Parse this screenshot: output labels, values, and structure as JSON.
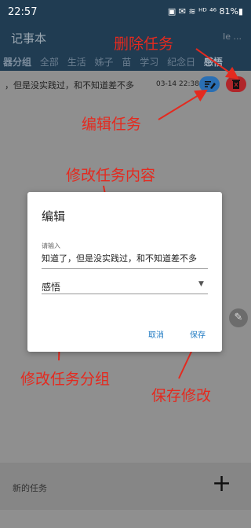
{
  "status_bar": {
    "time": "22:57",
    "indicators": "▣ ✉ ≋ ᴴᴰ ⁴⁶ 81%▮"
  },
  "app_bar": {
    "title": "记事本",
    "right_text": "Ie  ..."
  },
  "tabs": [
    "器分组",
    "全部",
    "生活",
    "姊子",
    "苗",
    "学习",
    "纪念日",
    "感悟"
  ],
  "task": {
    "text": "，但是没实践过，和不知道差不多",
    "date": "03-14 22:38"
  },
  "annotations": {
    "delete": "删除任务",
    "edit": "编辑任务",
    "modify_content": "修改任务内容",
    "modify_group": "修改任务分组",
    "save": "保存修改"
  },
  "dialog": {
    "title": "编辑",
    "input_label": "请输入",
    "input_value": "知道了，但是没实践过，和不知道差不多",
    "group_value": "感悟",
    "cancel_label": "取消",
    "save_label": "保存"
  },
  "bottom": {
    "new_task_placeholder": "新的任务",
    "add_symbol": "+"
  },
  "colors": {
    "header": "#203c52",
    "annotation": "#e42a1f",
    "link": "#1f7ac2"
  }
}
